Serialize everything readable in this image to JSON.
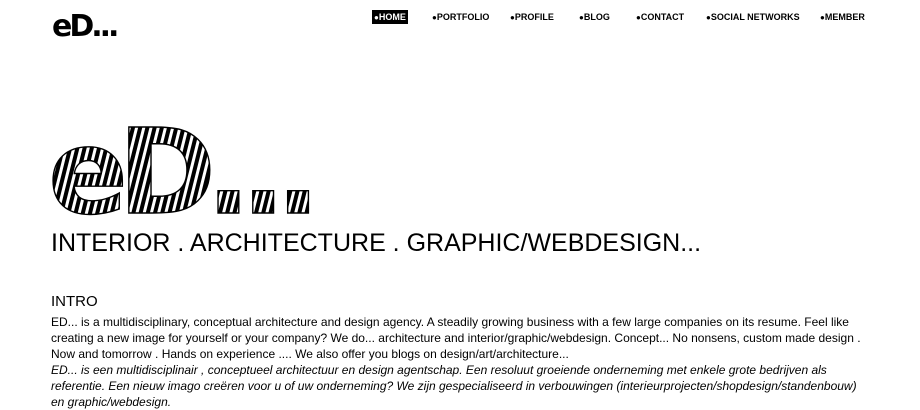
{
  "header": {
    "logo_text": "eD...",
    "nav": [
      {
        "label": "HOME",
        "active": true
      },
      {
        "label": "PORTFOLIO",
        "active": false
      },
      {
        "label": "PROFILE",
        "active": false
      },
      {
        "label": "BLOG",
        "active": false
      },
      {
        "label": "CONTACT",
        "active": false
      },
      {
        "label": "SOCIAL NETWORKS",
        "active": false
      },
      {
        "label": "MEMBER",
        "active": false
      }
    ]
  },
  "hero": {
    "logo_text": "eD...",
    "tagline": "INTERIOR . ARCHITECTURE . GRAPHIC/WEBDESIGN..."
  },
  "intro": {
    "heading": "INTRO",
    "paragraph_en": "ED... is a multidisciplinary, conceptual architecture and design agency. A steadily growing business with a few large companies on its resume. Feel like creating a new image for yourself or your company? We do... architecture and interior/graphic/webdesign.  Concept... No nonsens, custom made design . Now and tomorrow . Hands on experience ....  We also offer you blogs on design/art/architecture...",
    "paragraph_nl": "ED... is een multidisciplinair , conceptueel architectuur en design agentschap. Een resoluut groeiende onderneming met enkele grote bedrijven als referentie. Een nieuw imago creëren voor u of uw onderneming? We zijn gespecialiseerd in verbouwingen (interieurprojecten/shopdesign/standenbouw) en graphic/webdesign."
  }
}
